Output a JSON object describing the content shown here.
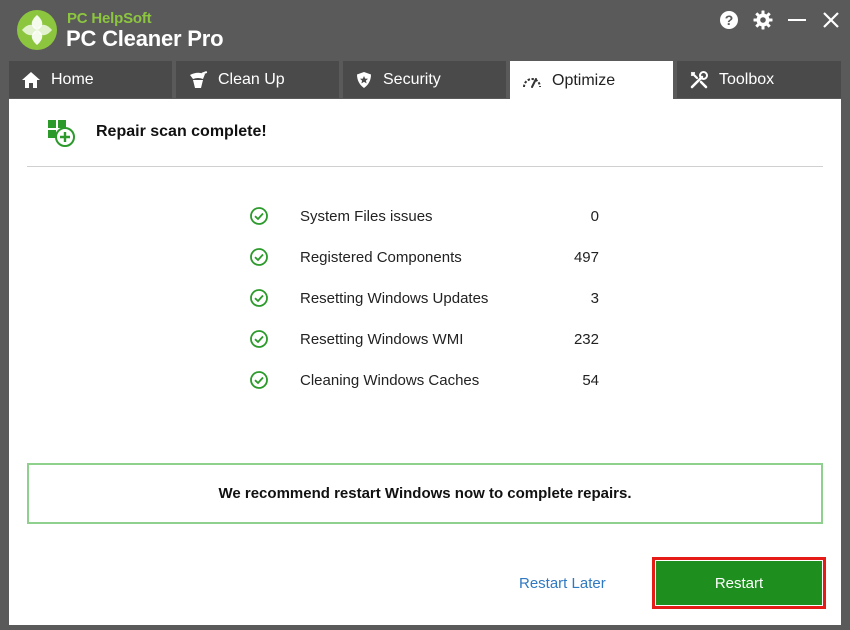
{
  "app": {
    "brand_small": "PC HelpSoft",
    "brand_big": "PC Cleaner Pro"
  },
  "window_controls": [
    "help-icon",
    "gear-icon",
    "minimize-icon",
    "close-icon"
  ],
  "tabs": [
    {
      "label": "Home",
      "icon": "home-icon",
      "active": false
    },
    {
      "label": "Clean Up",
      "icon": "broom-icon",
      "active": false
    },
    {
      "label": "Security",
      "icon": "shield-icon",
      "active": false
    },
    {
      "label": "Optimize",
      "icon": "gauge-icon",
      "active": true
    },
    {
      "label": "Toolbox",
      "icon": "tools-icon",
      "active": false
    }
  ],
  "main": {
    "status_title": "Repair scan complete!",
    "results": [
      {
        "label": "System Files issues",
        "value": "0"
      },
      {
        "label": "Registered Components",
        "value": "497"
      },
      {
        "label": "Resetting Windows Updates",
        "value": "3"
      },
      {
        "label": "Resetting Windows WMI",
        "value": "232"
      },
      {
        "label": "Cleaning Windows Caches",
        "value": "54"
      }
    ],
    "recommendation": "We recommend restart Windows now to complete repairs.",
    "restart_later_label": "Restart Later",
    "restart_label": "Restart"
  },
  "colors": {
    "accent_green": "#1e8e1e",
    "brand_green": "#8cc63f",
    "highlight_red": "#e41b17",
    "link_blue": "#2f79c2",
    "chrome_gray": "#5a5a5a"
  }
}
